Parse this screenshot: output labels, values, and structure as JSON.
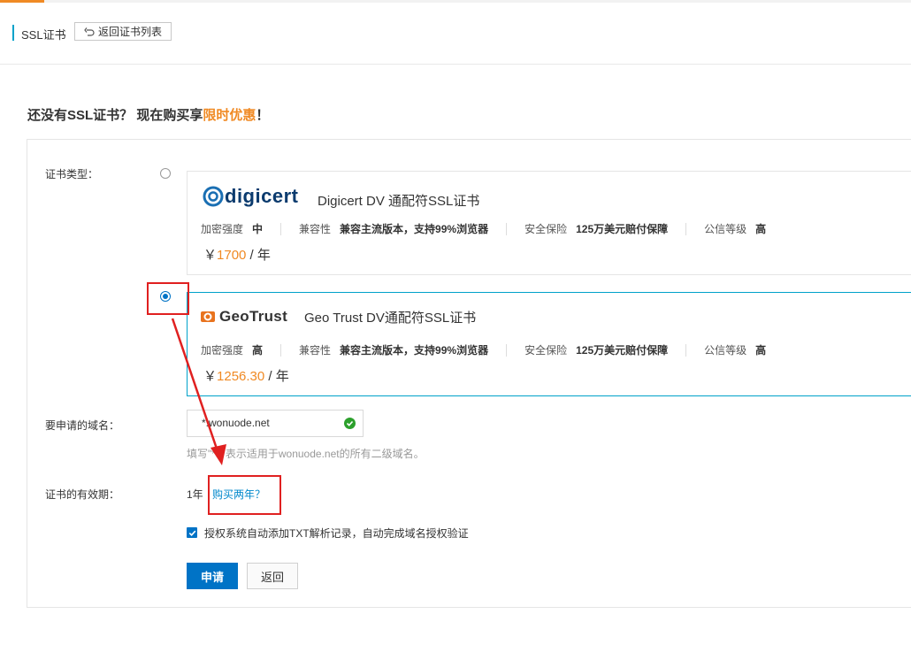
{
  "header": {
    "title": "SSL证书",
    "back_button": "返回证书列表"
  },
  "promo": {
    "text": "还没有SSL证书？ 现在购买享",
    "highlight": "限时优惠",
    "suffix": "！"
  },
  "form": {
    "cert_type_label": "证书类型：",
    "domain_label": "要申请的域名：",
    "validity_label": "证书的有效期："
  },
  "certs": [
    {
      "logo": "digicert",
      "logo_text": "digicert",
      "name": "Digicert DV 通配符SSL证书",
      "selected": false,
      "specs": [
        {
          "key": "加密强度",
          "value": "中"
        },
        {
          "key": "兼容性",
          "value": "兼容主流版本，支持99%浏览器"
        },
        {
          "key": "安全保险",
          "value": "125万美元赔付保障"
        },
        {
          "key": "公信等级",
          "value": "高"
        }
      ],
      "price_prefix": "￥",
      "price": "1700",
      "price_unit": " / 年"
    },
    {
      "logo": "geotrust",
      "logo_text": "GeoTrust",
      "name": "Geo Trust DV通配符SSL证书",
      "selected": true,
      "specs": [
        {
          "key": "加密强度",
          "value": "高"
        },
        {
          "key": "兼容性",
          "value": "兼容主流版本，支持99%浏览器"
        },
        {
          "key": "安全保险",
          "value": "125万美元赔付保障"
        },
        {
          "key": "公信等级",
          "value": "高"
        }
      ],
      "price_prefix": "￥",
      "price": "1256.30",
      "price_unit": " / 年"
    }
  ],
  "domain": {
    "value": "*.wonuode.net",
    "hint": "填写\"*.\" 表示适用于wonuode.net的所有二级域名。"
  },
  "validity": {
    "value": "1年",
    "link": "购买两年？"
  },
  "auto_txt": {
    "checked": true,
    "label": "授权系统自动添加TXT解析记录，自动完成域名授权验证"
  },
  "buttons": {
    "submit": "申请",
    "cancel": "返回"
  },
  "colors": {
    "accent": "#f08a24",
    "primary": "#0073c6",
    "teal": "#00a2ca",
    "annotation": "#e02020"
  }
}
